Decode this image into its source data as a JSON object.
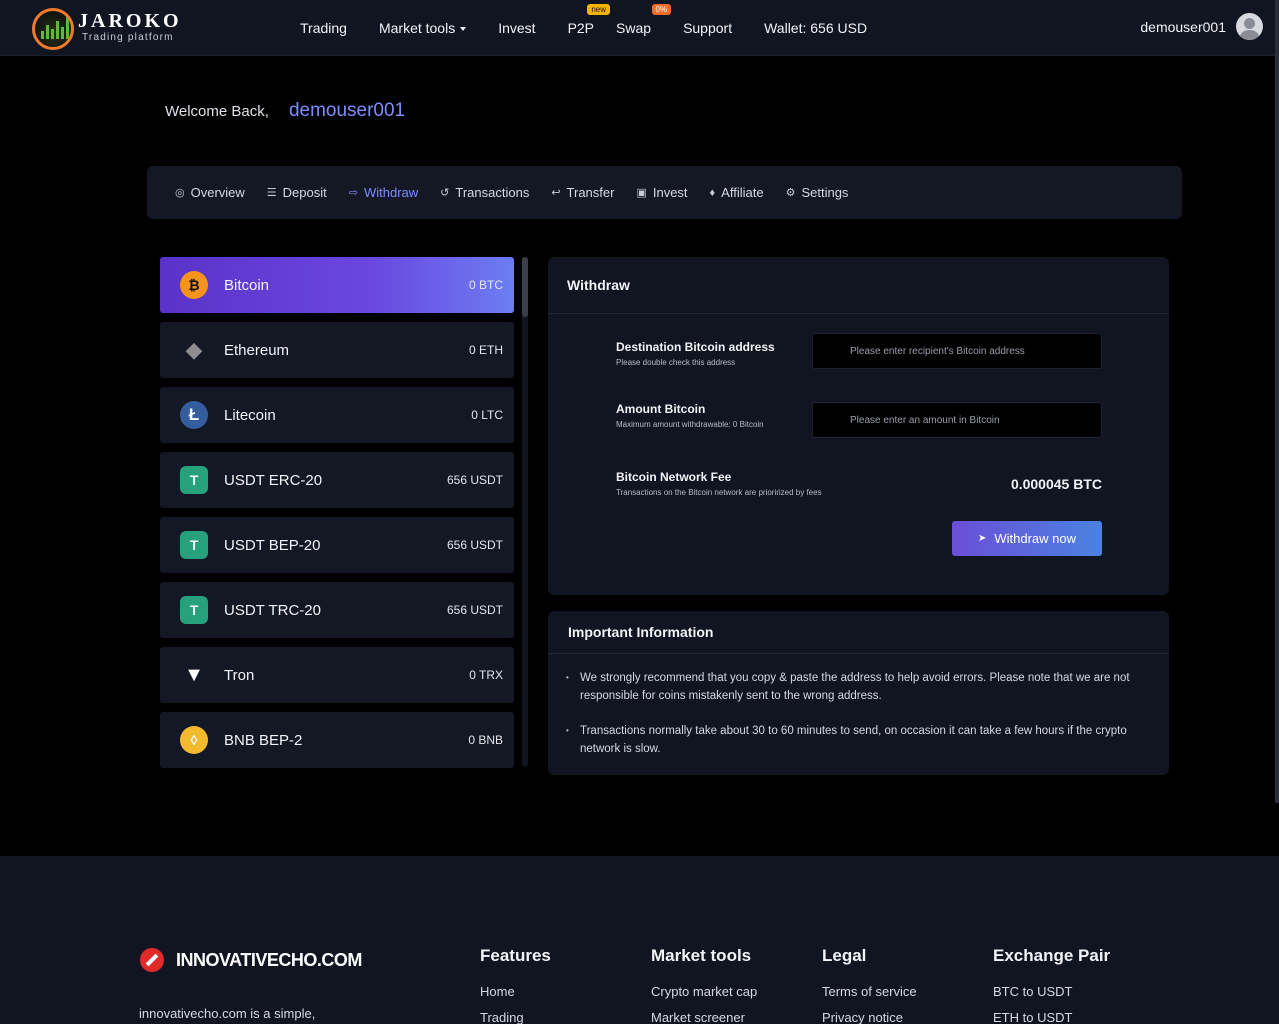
{
  "brand": {
    "name": "JAROKO",
    "tagline": "Trading platform"
  },
  "nav": {
    "trading": "Trading",
    "market_tools": "Market tools",
    "invest": "Invest",
    "p2p": "P2P",
    "p2p_badge": "new",
    "swap": "Swap",
    "swap_badge": "0%",
    "support": "Support",
    "wallet": "Wallet: 656 USD"
  },
  "user": {
    "name": "demouser001"
  },
  "welcome": {
    "label": "Welcome Back,",
    "user": "demouser001"
  },
  "tabs": [
    {
      "label": "Overview",
      "icon": "target-icon"
    },
    {
      "label": "Deposit",
      "icon": "database-icon"
    },
    {
      "label": "Withdraw",
      "icon": "arrow-right-icon"
    },
    {
      "label": "Transactions",
      "icon": "history-icon"
    },
    {
      "label": "Transfer",
      "icon": "reply-icon"
    },
    {
      "label": "Invest",
      "icon": "money-icon"
    },
    {
      "label": "Affiliate",
      "icon": "diamond-icon"
    },
    {
      "label": "Settings",
      "icon": "gear-icon"
    }
  ],
  "coins": [
    {
      "name": "Bitcoin",
      "balance": "0 BTC",
      "icon": "bitcoin-icon",
      "color": "#f7931a"
    },
    {
      "name": "Ethereum",
      "balance": "0 ETH",
      "icon": "ethereum-icon",
      "color": "#3c3c3d"
    },
    {
      "name": "Litecoin",
      "balance": "0 LTC",
      "icon": "litecoin-icon",
      "color": "#345d9d"
    },
    {
      "name": "USDT ERC-20",
      "balance": "656 USDT",
      "icon": "tether-icon",
      "color": "#26a17b"
    },
    {
      "name": "USDT BEP-20",
      "balance": "656 USDT",
      "icon": "tether-icon",
      "color": "#26a17b"
    },
    {
      "name": "USDT TRC-20",
      "balance": "656 USDT",
      "icon": "tether-icon",
      "color": "#26a17b"
    },
    {
      "name": "Tron",
      "balance": "0 TRX",
      "icon": "tron-icon",
      "color": "#ffffff"
    },
    {
      "name": "BNB BEP-2",
      "balance": "0 BNB",
      "icon": "bnb-icon",
      "color": "#f3ba2f"
    }
  ],
  "withdraw": {
    "title": "Withdraw",
    "address_label": "Destination Bitcoin address",
    "address_sub": "Please double check this address",
    "address_placeholder": "Please enter recipient's Bitcoin address",
    "amount_label": "Amount Bitcoin",
    "amount_sub": "Maximum amount withdrawable: 0 Bitcoin",
    "amount_placeholder": "Please enter an amount in Bitcoin",
    "fee_label": "Bitcoin Network Fee",
    "fee_sub": "Transactions on the Bitcoin network are priorirized by fees",
    "fee_value": "0.000045 BTC",
    "button": "Withdraw now"
  },
  "info": {
    "title": "Important Information",
    "items": [
      "We strongly recommend that you copy & paste the address to help avoid errors. Please note that we are not responsible for coins mistakenly sent to the wrong address.",
      "Transactions normally take about 30 to 60 minutes to send, on occasion it can take a few hours if the crypto network is slow."
    ]
  },
  "footer": {
    "brand": "INNOVATIVECHO.COM",
    "desc": "innovativecho.com is a simple,",
    "columns": [
      {
        "title": "Features",
        "links": [
          "Home",
          "Trading"
        ]
      },
      {
        "title": "Market tools",
        "links": [
          "Crypto market cap",
          "Market screener"
        ]
      },
      {
        "title": "Legal",
        "links": [
          "Terms of service",
          "Privacy notice"
        ]
      },
      {
        "title": "Exchange Pair",
        "links": [
          "BTC to USDT",
          "ETH to USDT"
        ]
      }
    ]
  }
}
